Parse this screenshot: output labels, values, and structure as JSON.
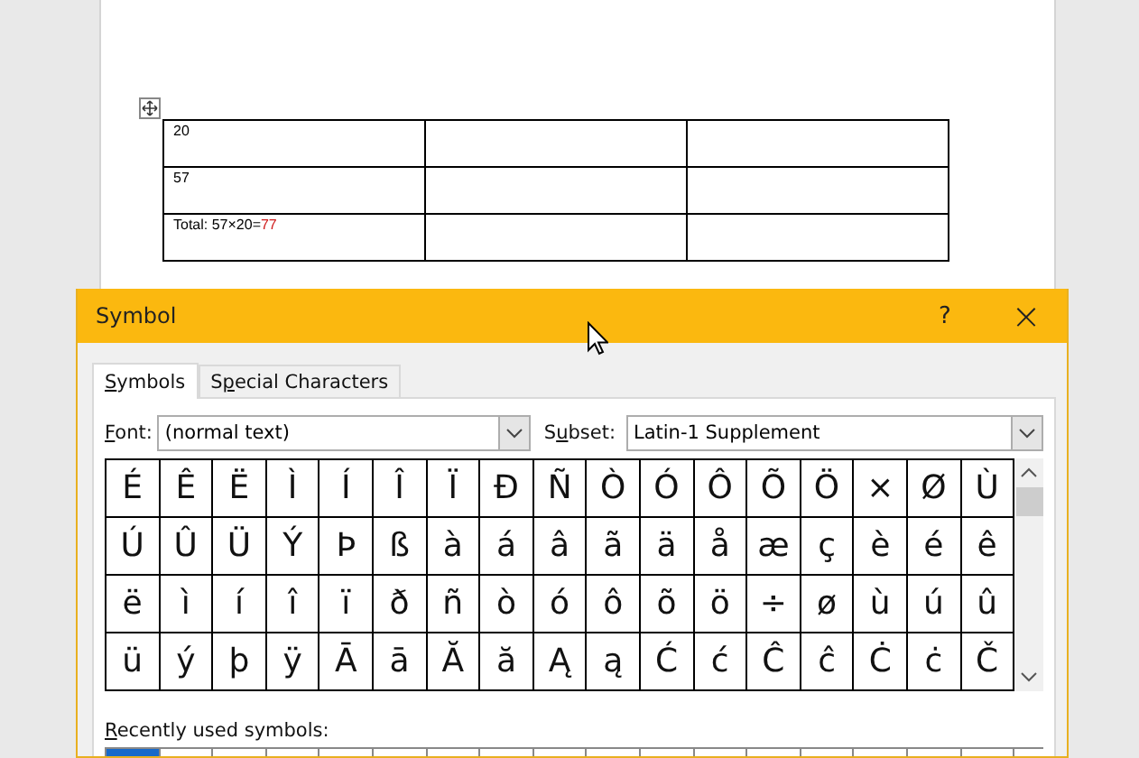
{
  "document": {
    "table": {
      "rows": [
        {
          "cells": [
            {
              "text": "20"
            },
            {
              "text": ""
            },
            {
              "text": ""
            }
          ]
        },
        {
          "cells": [
            {
              "text": "57"
            },
            {
              "text": ""
            },
            {
              "text": ""
            }
          ]
        },
        {
          "cells": [
            {
              "text": "Total: 57×20=",
              "field_result": "77"
            },
            {
              "text": ""
            },
            {
              "text": ""
            }
          ]
        }
      ]
    }
  },
  "dialog": {
    "title": "Symbol",
    "help": "?",
    "close": "×",
    "tabs": [
      {
        "label": {
          "key": "S",
          "rest": "ymbols"
        },
        "selected": true
      },
      {
        "label": {
          "lead": "S",
          "key": "p",
          "rest": "ecial Characters"
        },
        "selected": false
      }
    ],
    "font": {
      "label": {
        "key": "F",
        "rest": "ont:"
      },
      "value": "(normal text)"
    },
    "subset": {
      "label": {
        "lead": "S",
        "key": "u",
        "rest": "bset:"
      },
      "value": "Latin-1 Supplement"
    },
    "symbols": [
      [
        "É",
        "Ê",
        "Ë",
        "Ì",
        "Í",
        "Î",
        "Ï",
        "Ð",
        "Ñ",
        "Ò",
        "Ó",
        "Ô",
        "Õ",
        "Ö",
        "×",
        "Ø",
        "Ù"
      ],
      [
        "Ú",
        "Û",
        "Ü",
        "Ý",
        "Þ",
        "ß",
        "à",
        "á",
        "â",
        "ã",
        "ä",
        "å",
        "æ",
        "ç",
        "è",
        "é",
        "ê"
      ],
      [
        "ë",
        "ì",
        "í",
        "î",
        "ï",
        "ð",
        "ñ",
        "ò",
        "ó",
        "ô",
        "õ",
        "ö",
        "÷",
        "ø",
        "ù",
        "ú",
        "û"
      ],
      [
        "ü",
        "ý",
        "þ",
        "ÿ",
        "Ā",
        "ā",
        "Ă",
        "ă",
        "Ą",
        "ą",
        "Ć",
        "ć",
        "Ĉ",
        "ĉ",
        "Ċ",
        "ċ",
        "Č"
      ]
    ],
    "recent": {
      "label": {
        "key": "R",
        "rest": "ecently used symbols:"
      },
      "cells": [
        {
          "selected": true
        },
        {
          "selected": false
        },
        {
          "selected": false
        },
        {
          "selected": false
        },
        {
          "selected": false
        },
        {
          "selected": false
        },
        {
          "selected": false
        },
        {
          "selected": false
        },
        {
          "selected": false
        },
        {
          "selected": false
        },
        {
          "selected": false
        },
        {
          "selected": false
        },
        {
          "selected": false
        },
        {
          "selected": false
        },
        {
          "selected": false
        },
        {
          "selected": false
        },
        {
          "selected": false
        }
      ]
    }
  }
}
